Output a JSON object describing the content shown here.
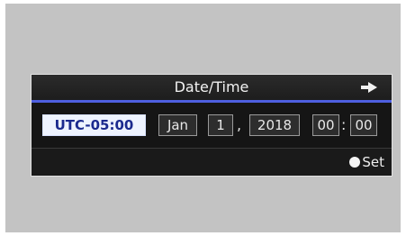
{
  "dialog": {
    "title": "Date/Time",
    "timezone": "UTC-05:00",
    "month": "Jan",
    "day": "1",
    "date_separator": ",",
    "year": "2018",
    "hour": "00",
    "time_separator": ":",
    "minute": "00",
    "set_label": "Set"
  },
  "icons": {
    "title_arrow": "return-arrow-icon",
    "set_button": "circle-button-icon"
  },
  "colors": {
    "screen_bg": "#c3c3c3",
    "dialog_bg": "#000000",
    "accent_line": "#4e5fe0",
    "selected_field_bg": "#eef3ff",
    "selected_field_text": "#1b2a8e"
  }
}
